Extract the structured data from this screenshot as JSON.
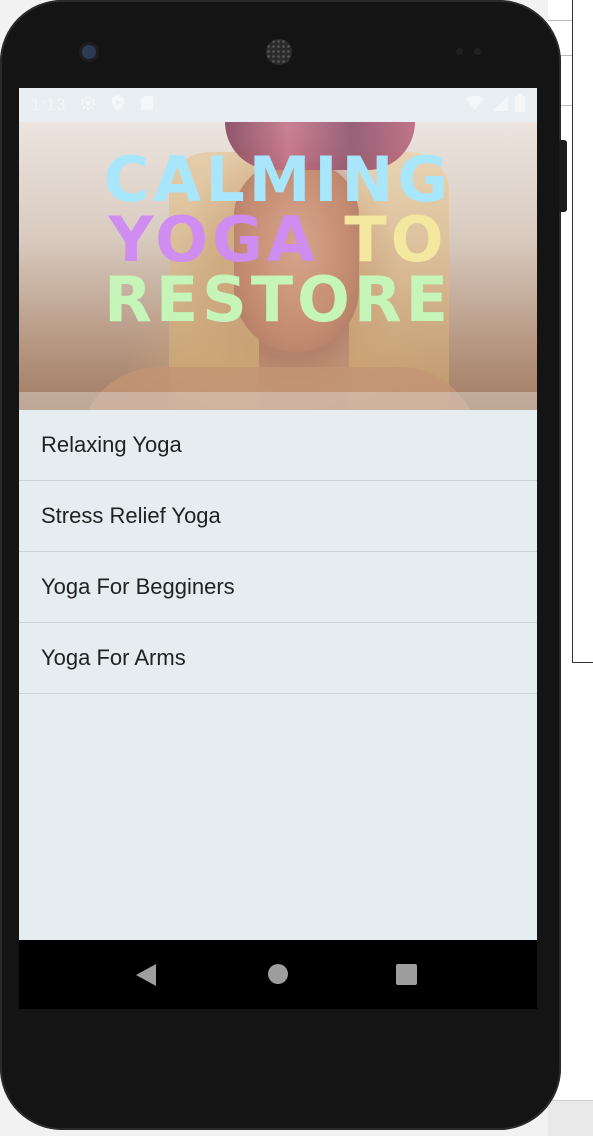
{
  "status_bar": {
    "time": "1:13",
    "icons": [
      "gear-icon",
      "shield-icon",
      "sd-card-icon"
    ],
    "right_icons": [
      "wifi-icon",
      "signal-icon",
      "battery-icon"
    ]
  },
  "hero": {
    "line1": "CALMING",
    "line2_a": "YOGA",
    "line2_b": "TO",
    "line3": "RESTORE"
  },
  "list": {
    "items": [
      {
        "label": "Relaxing Yoga"
      },
      {
        "label": "Stress Relief Yoga"
      },
      {
        "label": "Yoga For Begginers"
      },
      {
        "label": "Yoga For Arms"
      }
    ]
  },
  "nav_bar": {
    "buttons": [
      "back-icon",
      "home-icon",
      "recents-icon"
    ]
  },
  "colors": {
    "screen_bg": "#e6edf0",
    "title_blue": "#a7e6fb",
    "title_purple": "#cf8cf1",
    "title_yellow": "#f4e8a0",
    "title_green": "#c5f5b9"
  }
}
